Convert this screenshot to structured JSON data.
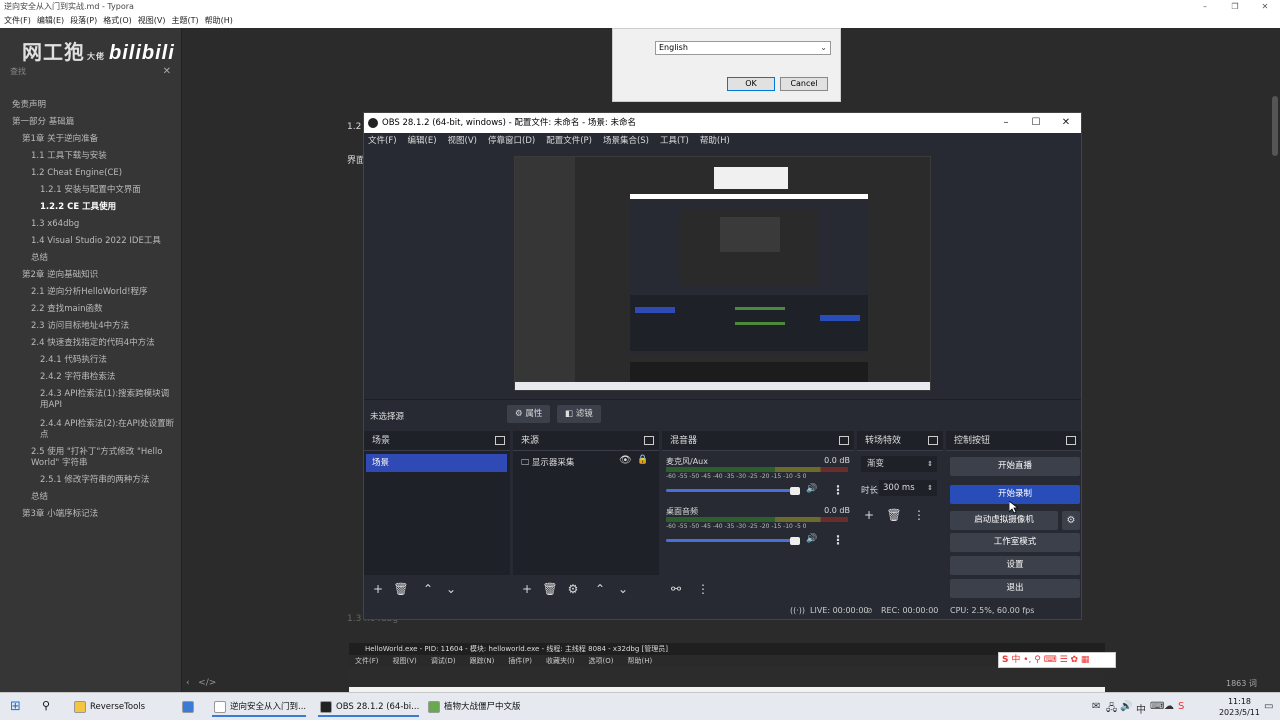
{
  "typora": {
    "title": "逆向安全从入门到实战.md - Typora",
    "menu": [
      "文件(F)",
      "编辑(E)",
      "段落(P)",
      "格式(O)",
      "视图(V)",
      "主题(T)",
      "帮助(H)"
    ],
    "logo_text": "网工狍",
    "logo_sub": "大佬",
    "logo_brand": "bilibili",
    "search_placeholder": "查找",
    "outline": [
      {
        "text": "免责声明",
        "level": 0,
        "active": false
      },
      {
        "text": "第一部分 基础篇",
        "level": 0,
        "active": false
      },
      {
        "text": "第1章 关于逆向准备",
        "level": 1,
        "active": false
      },
      {
        "text": "1.1 工具下载与安装",
        "level": 2,
        "active": false
      },
      {
        "text": "1.2 Cheat Engine(CE)",
        "level": 2,
        "active": false
      },
      {
        "text": "1.2.1 安装与配置中文界面",
        "level": 3,
        "active": false
      },
      {
        "text": "1.2.2 CE 工具使用",
        "level": 3,
        "active": true
      },
      {
        "text": "1.3 x64dbg",
        "level": 2,
        "active": false
      },
      {
        "text": "1.4 Visual Studio 2022 IDE工具",
        "level": 2,
        "active": false
      },
      {
        "text": "总结",
        "level": 2,
        "active": false
      },
      {
        "text": "第2章 逆向基础知识",
        "level": 1,
        "active": false
      },
      {
        "text": "2.1 逆向分析HelloWorld!程序",
        "level": 2,
        "active": false
      },
      {
        "text": "2.2 查找main函数",
        "level": 2,
        "active": false
      },
      {
        "text": "2.3 访问目标地址4中方法",
        "level": 2,
        "active": false
      },
      {
        "text": "2.4 快速查找指定的代码4中方法",
        "level": 2,
        "active": false
      },
      {
        "text": "2.4.1 代码执行法",
        "level": 3,
        "active": false
      },
      {
        "text": "2.4.2 字符串检索法",
        "level": 3,
        "active": false
      },
      {
        "text": "2.4.3 API检索法(1):搜索跨模块调用API",
        "level": 3,
        "active": false
      },
      {
        "text": "2.4.4 API检索法(2):在API处设置断点",
        "level": 3,
        "active": false
      },
      {
        "text": "2.5 使用 \"打补丁\"方式修改 \"Hello World\" 字符串",
        "level": 2,
        "active": false
      },
      {
        "text": "2.5.1 修改字符串的两种方法",
        "level": 3,
        "active": false
      },
      {
        "text": "总结",
        "level": 2,
        "active": false
      },
      {
        "text": "第3章 小端序标记法",
        "level": 1,
        "active": false
      }
    ],
    "word_count": "1863 词",
    "content_frag_1": "1.2",
    "content_frag_2": "界面",
    "content_frag_3": "1.3 x64dbg"
  },
  "lang_dialog": {
    "selected": "English",
    "ok_label": "OK",
    "cancel_label": "Cancel"
  },
  "x64dbg": {
    "title": "HelloWorld.exe - PID: 11604 - 模块: helloworld.exe - 线程: 主线程 8084 - x32dbg [管理员]",
    "menu": [
      "文件(F)",
      "视图(V)",
      "调试(D)",
      "跟踪(N)",
      "插件(P)",
      "收藏夹(I)",
      "选项(O)",
      "帮助(H)"
    ]
  },
  "obs": {
    "title": "OBS 28.1.2 (64-bit, windows) - 配置文件: 未命名 - 场景: 未命名",
    "menu": [
      "文件(F)",
      "编辑(E)",
      "视图(V)",
      "停靠窗口(D)",
      "配置文件(P)",
      "场景集合(S)",
      "工具(T)",
      "帮助(H)"
    ],
    "no_source": "未选择源",
    "properties_label": "属性",
    "filters_label": "滤镜",
    "scenes": {
      "header": "场景",
      "items": [
        "场景"
      ]
    },
    "sources": {
      "header": "来源",
      "items": [
        "显示器采集"
      ]
    },
    "mixer": {
      "header": "混音器",
      "channels": [
        {
          "name": "麦克风/Aux",
          "db": "0.0 dB",
          "volume": 1.0
        },
        {
          "name": "桌面音频",
          "db": "0.0 dB",
          "volume": 1.0
        }
      ],
      "ticks": "-60 -55 -50 -45 -40 -35 -30 -25 -20 -15 -10 -5 0"
    },
    "transitions": {
      "header": "转场特效",
      "selected": "渐变",
      "duration_label": "时长",
      "duration_value": "300 ms"
    },
    "controls": {
      "header": "控制按钮",
      "start_stream": "开始直播",
      "start_record": "开始录制",
      "virtual_cam": "启动虚拟摄像机",
      "studio_mode": "工作室模式",
      "settings": "设置",
      "exit": "退出"
    },
    "status": {
      "live": "LIVE: 00:00:00",
      "rec": "REC: 00:00:00",
      "cpu": "CPU: 2.5%, 60.00 fps"
    }
  },
  "taskbar": {
    "apps": [
      {
        "label": "ReverseTools",
        "color": "#f5c542",
        "active": false
      },
      {
        "label": "",
        "color": "#3a7bd5",
        "active": false
      },
      {
        "label": "逆向安全从入门到...",
        "color": "#ffffff",
        "active": true
      },
      {
        "label": "OBS 28.1.2 (64-bi...",
        "color": "#222222",
        "active": true
      },
      {
        "label": "植物大战僵尸中文版",
        "color": "#6aa84f",
        "active": false
      }
    ],
    "ime_label": "中",
    "time": "11:18",
    "date": "2023/5/11"
  }
}
